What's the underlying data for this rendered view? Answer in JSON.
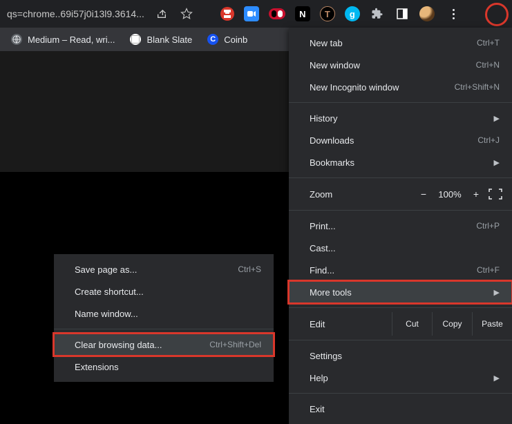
{
  "toolbar": {
    "address": "qs=chrome..69i57j0i13l9.3614..."
  },
  "bookmarks": [
    {
      "label": "Medium – Read, wri..."
    },
    {
      "label": "Blank Slate"
    },
    {
      "label": "Coinb"
    }
  ],
  "mainMenu": {
    "newTab": {
      "label": "New tab",
      "shortcut": "Ctrl+T"
    },
    "newWindow": {
      "label": "New window",
      "shortcut": "Ctrl+N"
    },
    "newIncognito": {
      "label": "New Incognito window",
      "shortcut": "Ctrl+Shift+N"
    },
    "history": {
      "label": "History"
    },
    "downloads": {
      "label": "Downloads",
      "shortcut": "Ctrl+J"
    },
    "bookmarks": {
      "label": "Bookmarks"
    },
    "zoom": {
      "label": "Zoom",
      "minus": "−",
      "value": "100%",
      "plus": "+"
    },
    "print": {
      "label": "Print...",
      "shortcut": "Ctrl+P"
    },
    "cast": {
      "label": "Cast..."
    },
    "find": {
      "label": "Find...",
      "shortcut": "Ctrl+F"
    },
    "moreTools": {
      "label": "More tools"
    },
    "edit": {
      "label": "Edit",
      "cut": "Cut",
      "copy": "Copy",
      "paste": "Paste"
    },
    "settings": {
      "label": "Settings"
    },
    "help": {
      "label": "Help"
    },
    "exit": {
      "label": "Exit"
    }
  },
  "subMenu": {
    "savePage": {
      "label": "Save page as...",
      "shortcut": "Ctrl+S"
    },
    "createShortcut": {
      "label": "Create shortcut..."
    },
    "nameWindow": {
      "label": "Name window..."
    },
    "clearData": {
      "label": "Clear browsing data...",
      "shortcut": "Ctrl+Shift+Del"
    },
    "extensions": {
      "label": "Extensions"
    }
  }
}
